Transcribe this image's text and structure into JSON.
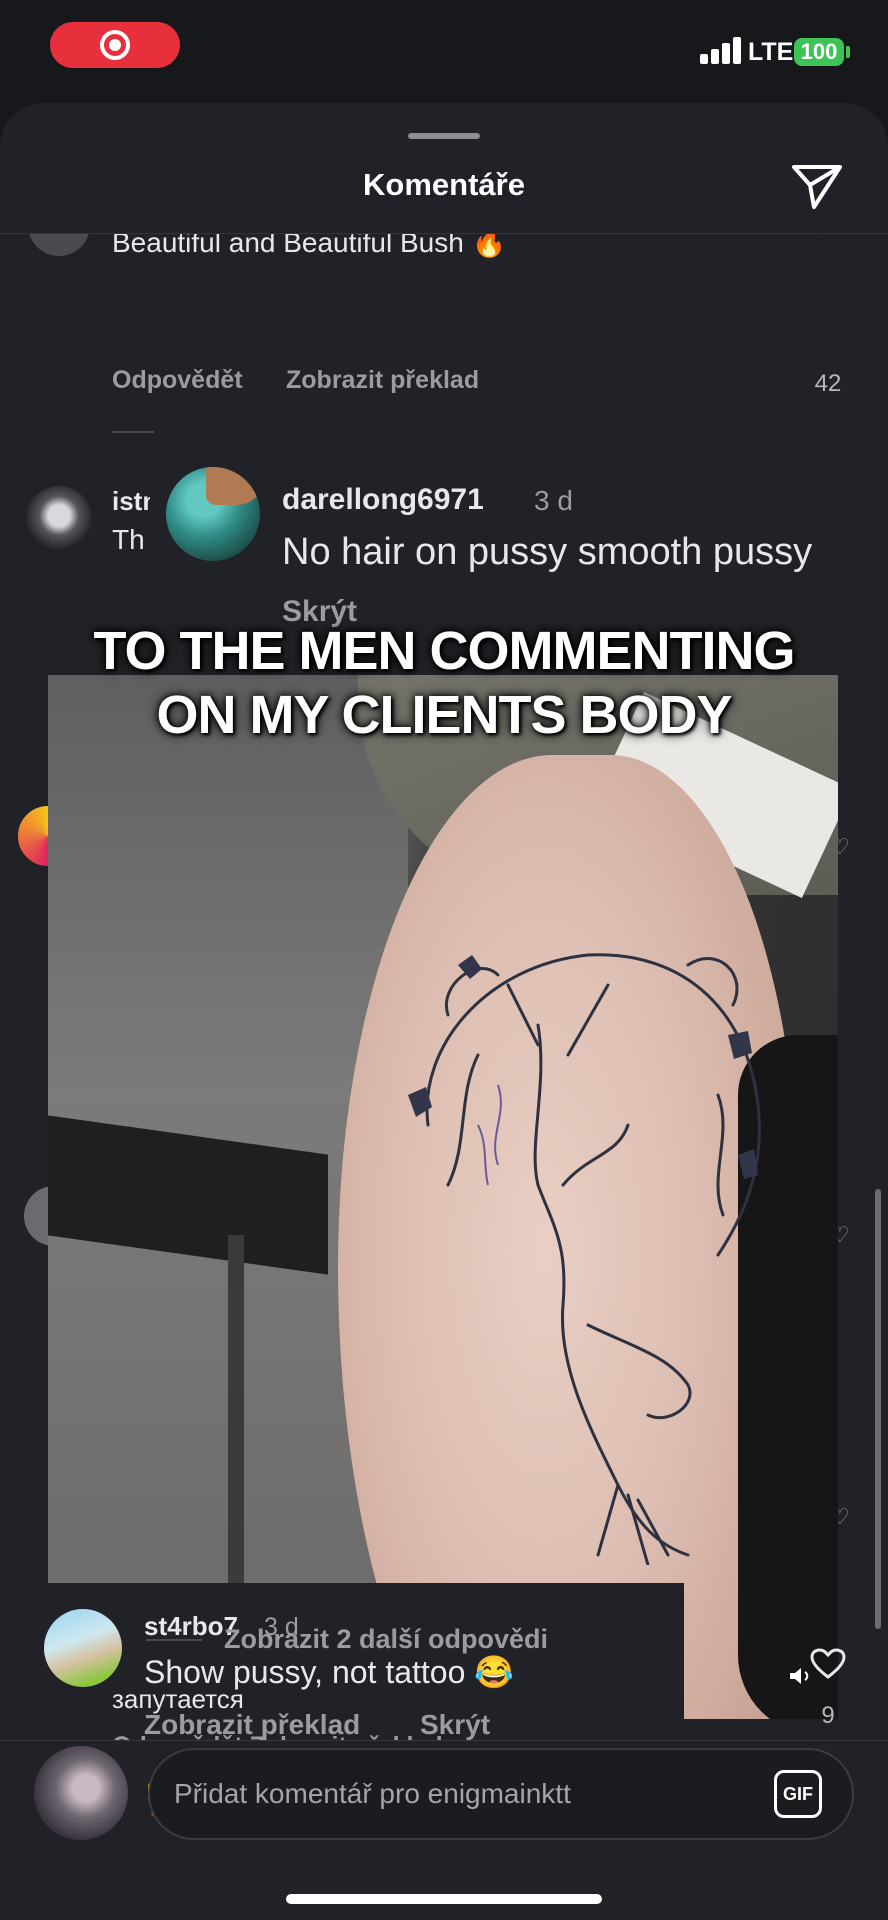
{
  "status_bar": {
    "network": "LTE",
    "battery": "100"
  },
  "sheet": {
    "title": "Komentáře"
  },
  "comments": {
    "top": {
      "text_partial": "Beautiful and Beautiful Bush 🔥",
      "reply_label": "Odpovědět",
      "translate_label": "Zobrazit překlad",
      "likes": "42"
    },
    "istn": {
      "username_partial": "istn",
      "text_partial": "Th"
    },
    "darellong": {
      "username": "darellong6971",
      "time": "3 d",
      "text": "No hair on pussy smooth pussy",
      "hide_label": "Skrýt"
    },
    "st4rbo7": {
      "username": "st4rbo7",
      "time": "3 d",
      "text": "Show pussy, not tattoo 😂",
      "translate_label": "Zobrazit překlad",
      "hide_label": "Skrýt"
    },
    "more_replies": "Zobrazit 2 další odpovědi",
    "bottom": {
      "text": "запутается",
      "meta_partial": "Odpovědět   Zobrazit překlad",
      "likes": "9"
    }
  },
  "video": {
    "overlay_line1": "TO THE MEN COMMENTING",
    "overlay_line2": "ON MY CLIENTS BODY"
  },
  "emoji_bar": [
    "❤️",
    "🙌",
    "🔥",
    "👏",
    "😢",
    "😍",
    "😮",
    "😂"
  ],
  "comment_input": {
    "placeholder": "Přidat komentář pro enigmainktt",
    "gif_label": "GIF"
  },
  "icons": {
    "send": "send-icon",
    "heart": "heart-icon",
    "volume": "volume-icon",
    "record": "screen-record-icon"
  }
}
